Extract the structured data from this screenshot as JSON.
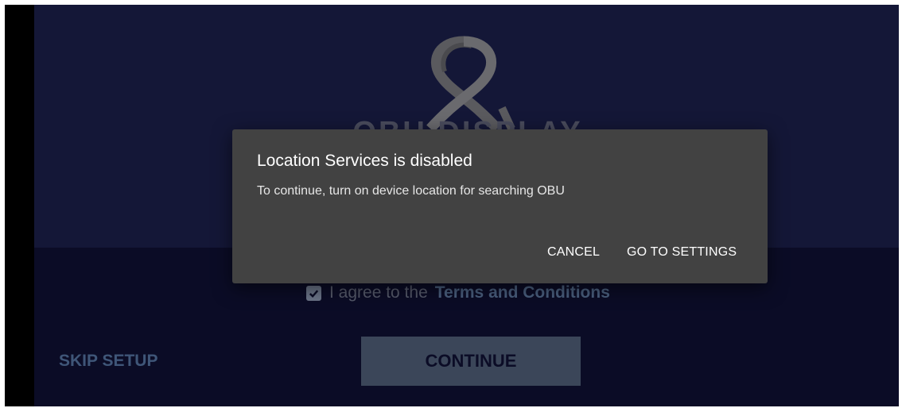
{
  "app": {
    "brand": "OBU DISPLAY",
    "agree_text": "I agree to the",
    "terms_link": "Terms and Conditions",
    "terms_checked": true,
    "skip_label": "SKIP SETUP",
    "continue_label": "CONTINUE"
  },
  "dialog": {
    "title": "Location Services is disabled",
    "message": "To continue, turn on device location for searching OBU",
    "cancel_label": "CANCEL",
    "settings_label": "GO TO SETTINGS"
  },
  "colors": {
    "app_background": "#0b0c26",
    "dialog_background": "#424242",
    "continue_button": "#3b4659",
    "link": "#4a5f7e"
  },
  "icons": {
    "logo": "ribbon-loop-logo",
    "checkbox": "check-icon"
  }
}
